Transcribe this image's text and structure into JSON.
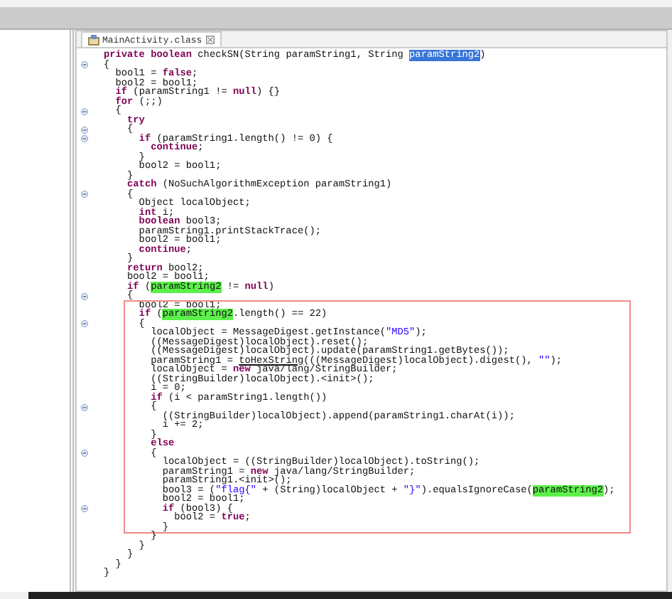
{
  "editor": {
    "tab": {
      "label": "MainActivity.class",
      "selected": true
    },
    "blocks": [
      {
        "kind": "plain",
        "lines": [
          {
            "fold": false,
            "segs": [
              {
                "kind": "keyword",
                "text": "private boolean "
              },
              {
                "kind": "plain",
                "text": "checkSN(String paramString1, String "
              },
              {
                "kind": "selection",
                "text": "paramString2"
              },
              {
                "kind": "plain",
                "text": ")"
              }
            ]
          },
          {
            "fold": true,
            "segs": [
              {
                "kind": "plain",
                "text": "{"
              }
            ]
          },
          {
            "fold": false,
            "segs": [
              {
                "kind": "plain",
                "text": "  bool1 = "
              },
              {
                "kind": "keyword",
                "text": "false"
              },
              {
                "kind": "plain",
                "text": ";"
              }
            ]
          },
          {
            "fold": false,
            "segs": [
              {
                "kind": "plain",
                "text": "  bool2 = bool1;"
              }
            ]
          },
          {
            "fold": false,
            "segs": [
              {
                "kind": "keyword",
                "text": "  if"
              },
              {
                "kind": "plain",
                "text": " (paramString1 != "
              },
              {
                "kind": "keyword",
                "text": "null"
              },
              {
                "kind": "plain",
                "text": ") {}"
              }
            ]
          },
          {
            "fold": false,
            "segs": [
              {
                "kind": "keyword",
                "text": "  for"
              },
              {
                "kind": "plain",
                "text": " (;;)"
              }
            ]
          },
          {
            "fold": true,
            "segs": [
              {
                "kind": "plain",
                "text": "  {"
              }
            ]
          },
          {
            "fold": false,
            "segs": [
              {
                "kind": "keyword",
                "text": "    try"
              }
            ]
          },
          {
            "fold": true,
            "segs": [
              {
                "kind": "plain",
                "text": "    {"
              }
            ]
          },
          {
            "fold": true,
            "segs": [
              {
                "kind": "keyword",
                "text": "      if"
              },
              {
                "kind": "plain",
                "text": " (paramString1.length() != 0) {"
              }
            ]
          },
          {
            "fold": false,
            "segs": [
              {
                "kind": "keyword",
                "text": "        continue"
              },
              {
                "kind": "plain",
                "text": ";"
              }
            ]
          },
          {
            "fold": false,
            "segs": [
              {
                "kind": "plain",
                "text": "      }"
              }
            ]
          },
          {
            "fold": false,
            "segs": [
              {
                "kind": "plain",
                "text": "      bool2 = bool1;"
              }
            ]
          },
          {
            "fold": false,
            "segs": [
              {
                "kind": "plain",
                "text": "    }"
              }
            ]
          },
          {
            "fold": false,
            "segs": [
              {
                "kind": "keyword",
                "text": "    catch"
              },
              {
                "kind": "plain",
                "text": " (NoSuchAlgorithmException paramString1)"
              }
            ]
          },
          {
            "fold": true,
            "segs": [
              {
                "kind": "plain",
                "text": "    {"
              }
            ]
          },
          {
            "fold": false,
            "segs": [
              {
                "kind": "plain",
                "text": "      Object localObject;"
              }
            ]
          },
          {
            "fold": false,
            "segs": [
              {
                "kind": "keyword",
                "text": "      int"
              },
              {
                "kind": "plain",
                "text": " i;"
              }
            ]
          },
          {
            "fold": false,
            "segs": [
              {
                "kind": "keyword",
                "text": "      boolean"
              },
              {
                "kind": "plain",
                "text": " bool3;"
              }
            ]
          },
          {
            "fold": false,
            "segs": [
              {
                "kind": "plain",
                "text": "      paramString1.printStackTrace();"
              }
            ]
          },
          {
            "fold": false,
            "segs": [
              {
                "kind": "plain",
                "text": "      bool2 = bool1;"
              }
            ]
          },
          {
            "fold": false,
            "segs": [
              {
                "kind": "keyword",
                "text": "      continue"
              },
              {
                "kind": "plain",
                "text": ";"
              }
            ]
          },
          {
            "fold": false,
            "segs": [
              {
                "kind": "plain",
                "text": "    }"
              }
            ]
          },
          {
            "fold": false,
            "segs": [
              {
                "kind": "keyword",
                "text": "    return"
              },
              {
                "kind": "plain",
                "text": " bool2;"
              }
            ]
          },
          {
            "fold": false,
            "segs": [
              {
                "kind": "plain",
                "text": "    bool2 = bool1;"
              }
            ]
          },
          {
            "fold": false,
            "segs": [
              {
                "kind": "keyword",
                "text": "    if"
              },
              {
                "kind": "plain",
                "text": " ("
              },
              {
                "kind": "occurrence",
                "text": "paramString2"
              },
              {
                "kind": "plain",
                "text": " != "
              },
              {
                "kind": "keyword",
                "text": "null"
              },
              {
                "kind": "plain",
                "text": ")"
              }
            ]
          },
          {
            "fold": true,
            "segs": [
              {
                "kind": "plain",
                "text": "    {"
              }
            ]
          }
        ]
      },
      {
        "kind": "boxed",
        "lines": [
          {
            "fold": false,
            "segs": [
              {
                "kind": "plain",
                "text": "      bool2 = bool1;"
              }
            ]
          },
          {
            "fold": false,
            "segs": [
              {
                "kind": "keyword",
                "text": "      if"
              },
              {
                "kind": "plain",
                "text": " ("
              },
              {
                "kind": "occurrence",
                "text": "paramString2"
              },
              {
                "kind": "plain",
                "text": ".length() == 22)"
              }
            ]
          },
          {
            "fold": true,
            "segs": [
              {
                "kind": "plain",
                "text": "      {"
              }
            ]
          },
          {
            "fold": false,
            "segs": [
              {
                "kind": "plain",
                "text": "        localObject = MessageDigest.getInstance("
              },
              {
                "kind": "string",
                "text": "\"MD5\""
              },
              {
                "kind": "plain",
                "text": ");"
              }
            ]
          },
          {
            "fold": false,
            "segs": [
              {
                "kind": "plain",
                "text": "        ((MessageDigest)localObject).reset();"
              }
            ]
          },
          {
            "fold": false,
            "segs": [
              {
                "kind": "plain",
                "text": "        ((MessageDigest)localObject).update(paramString1.getBytes());"
              }
            ]
          },
          {
            "fold": false,
            "segs": [
              {
                "kind": "plain",
                "text": "        paramString1 = "
              },
              {
                "kind": "underlined",
                "text": "toHexString"
              },
              {
                "kind": "plain",
                "text": "(((MessageDigest)localObject).digest(), "
              },
              {
                "kind": "string",
                "text": "\"\""
              },
              {
                "kind": "plain",
                "text": ");"
              }
            ]
          },
          {
            "fold": false,
            "segs": [
              {
                "kind": "plain",
                "text": "        localObject = "
              },
              {
                "kind": "keyword",
                "text": "new"
              },
              {
                "kind": "plain",
                "text": " java/lang/StringBuilder;"
              }
            ]
          },
          {
            "fold": false,
            "segs": [
              {
                "kind": "plain",
                "text": "        ((StringBuilder)localObject).<init>();"
              }
            ]
          },
          {
            "fold": false,
            "segs": [
              {
                "kind": "plain",
                "text": "        i = 0;"
              }
            ]
          },
          {
            "fold": false,
            "segs": [
              {
                "kind": "keyword",
                "text": "        if"
              },
              {
                "kind": "plain",
                "text": " (i < paramString1.length())"
              }
            ]
          },
          {
            "fold": true,
            "segs": [
              {
                "kind": "plain",
                "text": "        {"
              }
            ]
          },
          {
            "fold": false,
            "segs": [
              {
                "kind": "plain",
                "text": "          ((StringBuilder)localObject).append(paramString1.charAt(i));"
              }
            ]
          },
          {
            "fold": false,
            "segs": [
              {
                "kind": "plain",
                "text": "          i += 2;"
              }
            ]
          },
          {
            "fold": false,
            "segs": [
              {
                "kind": "plain",
                "text": "        }"
              }
            ]
          },
          {
            "fold": false,
            "segs": [
              {
                "kind": "keyword",
                "text": "        else"
              }
            ]
          },
          {
            "fold": true,
            "segs": [
              {
                "kind": "plain",
                "text": "        {"
              }
            ]
          },
          {
            "fold": false,
            "segs": [
              {
                "kind": "plain",
                "text": "          localObject = ((StringBuilder)localObject).toString();"
              }
            ]
          },
          {
            "fold": false,
            "segs": [
              {
                "kind": "plain",
                "text": "          paramString1 = "
              },
              {
                "kind": "keyword",
                "text": "new"
              },
              {
                "kind": "plain",
                "text": " java/lang/StringBuilder;"
              }
            ]
          },
          {
            "fold": false,
            "segs": [
              {
                "kind": "plain",
                "text": "          paramString1.<init>();"
              }
            ]
          },
          {
            "fold": false,
            "segs": [
              {
                "kind": "plain",
                "text": "          bool3 = ("
              },
              {
                "kind": "string",
                "text": "\"flag{\""
              },
              {
                "kind": "plain",
                "text": " + (String)localObject + "
              },
              {
                "kind": "string",
                "text": "\"}\""
              },
              {
                "kind": "plain",
                "text": ").equalsIgnoreCase("
              },
              {
                "kind": "occurrence",
                "text": "paramString2"
              },
              {
                "kind": "plain",
                "text": ");"
              }
            ]
          },
          {
            "fold": false,
            "segs": [
              {
                "kind": "plain",
                "text": "          bool2 = bool1;"
              }
            ]
          },
          {
            "fold": true,
            "segs": [
              {
                "kind": "keyword",
                "text": "          if"
              },
              {
                "kind": "plain",
                "text": " (bool3) {"
              }
            ]
          },
          {
            "fold": false,
            "segs": [
              {
                "kind": "plain",
                "text": "            bool2 = "
              },
              {
                "kind": "keyword",
                "text": "true"
              },
              {
                "kind": "plain",
                "text": ";"
              }
            ]
          },
          {
            "fold": false,
            "segs": [
              {
                "kind": "plain",
                "text": "          }"
              }
            ]
          }
        ]
      },
      {
        "kind": "plain",
        "lines": [
          {
            "fold": false,
            "segs": [
              {
                "kind": "plain",
                "text": "        }"
              }
            ]
          },
          {
            "fold": false,
            "segs": [
              {
                "kind": "plain",
                "text": "      }"
              }
            ]
          },
          {
            "fold": false,
            "segs": [
              {
                "kind": "plain",
                "text": "    }"
              }
            ]
          },
          {
            "fold": false,
            "segs": [
              {
                "kind": "plain",
                "text": "  }"
              }
            ]
          },
          {
            "fold": false,
            "segs": [
              {
                "kind": "plain",
                "text": "}"
              }
            ]
          }
        ]
      }
    ]
  }
}
